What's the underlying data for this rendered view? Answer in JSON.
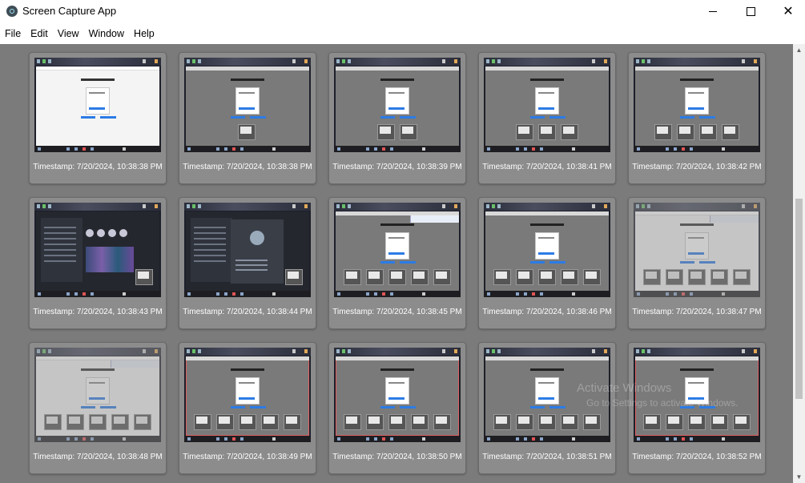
{
  "window": {
    "title": "Screen Capture App",
    "controls": [
      "minimize",
      "maximize",
      "close"
    ]
  },
  "menu": [
    "File",
    "Edit",
    "View",
    "Window",
    "Help"
  ],
  "captures": [
    {
      "timestamp": "Timestamp: 7/20/2024, 10:38:38 PM"
    },
    {
      "timestamp": "Timestamp: 7/20/2024, 10:38:38 PM"
    },
    {
      "timestamp": "Timestamp: 7/20/2024, 10:38:39 PM"
    },
    {
      "timestamp": "Timestamp: 7/20/2024, 10:38:41 PM"
    },
    {
      "timestamp": "Timestamp: 7/20/2024, 10:38:42 PM"
    },
    {
      "timestamp": "Timestamp: 7/20/2024, 10:38:43 PM"
    },
    {
      "timestamp": "Timestamp: 7/20/2024, 10:38:44 PM"
    },
    {
      "timestamp": "Timestamp: 7/20/2024, 10:38:45 PM"
    },
    {
      "timestamp": "Timestamp: 7/20/2024, 10:38:46 PM"
    },
    {
      "timestamp": "Timestamp: 7/20/2024, 10:38:47 PM"
    },
    {
      "timestamp": "Timestamp: 7/20/2024, 10:38:48 PM"
    },
    {
      "timestamp": "Timestamp: 7/20/2024, 10:38:49 PM"
    },
    {
      "timestamp": "Timestamp: 7/20/2024, 10:38:50 PM"
    },
    {
      "timestamp": "Timestamp: 7/20/2024, 10:38:51 PM"
    },
    {
      "timestamp": "Timestamp: 7/20/2024, 10:38:52 PM"
    }
  ],
  "watermark": {
    "line1": "Activate Windows",
    "line2": "Go to Settings to activate Windows."
  },
  "colors": {
    "content_bg": "#7b7b7b",
    "card_bg": "#8c8c8c",
    "accent": "#2c7be5"
  }
}
